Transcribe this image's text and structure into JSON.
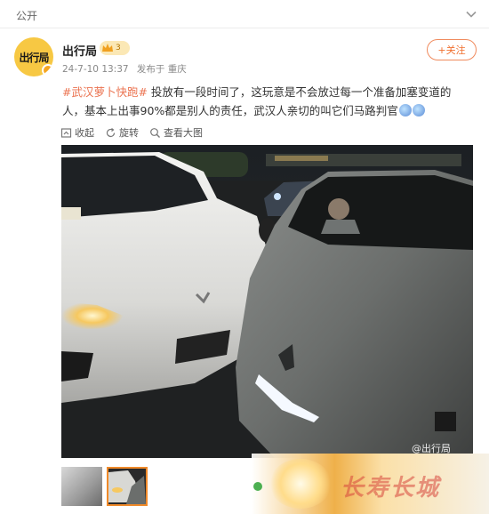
{
  "topbar": {
    "visibility": "公开"
  },
  "author": {
    "name": "出行局",
    "avatar_text": "出行局",
    "badge_level": "3",
    "time": "24-7-10 13:37",
    "source": "发布于 重庆",
    "follow_label": "+关注"
  },
  "post": {
    "tag": "#武汉萝卜快跑#",
    "text": " 投放有一段时间了，这玩意是不会放过每一个准备加塞变道的人，基本上出事90%都是别人的责任，武汉人亲切的叫它们马路判官"
  },
  "actions": [
    {
      "label": "收起",
      "icon": "collapse-icon"
    },
    {
      "label": "旋转",
      "icon": "rotate-icon"
    },
    {
      "label": "查看大图",
      "icon": "magnify-icon"
    }
  ],
  "photo": {
    "watermark": "@出行局"
  },
  "overlay": {
    "brand": "长寿长城"
  }
}
